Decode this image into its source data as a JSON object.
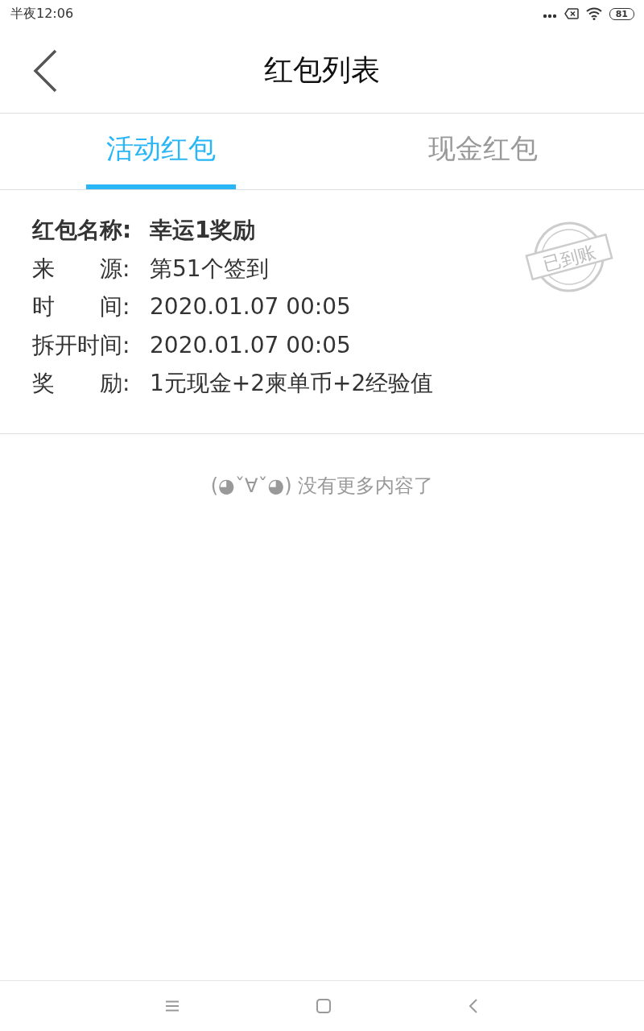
{
  "status_bar": {
    "time": "半夜12:06",
    "battery": "81"
  },
  "header": {
    "title": "红包列表"
  },
  "tabs": [
    {
      "label": "活动红包",
      "selected": true
    },
    {
      "label": "现金红包",
      "selected": false
    }
  ],
  "card": {
    "stamp": "已到账",
    "fields": [
      {
        "label": "红包名称:",
        "value": "幸运1奖励",
        "bold": true
      },
      {
        "label": "来　　源:",
        "value": "第51个签到",
        "bold": false
      },
      {
        "label": "时　　间:",
        "value": "2020.01.07 00:05",
        "bold": false
      },
      {
        "label": "拆开时间:",
        "value": "2020.01.07 00:05",
        "bold": false
      },
      {
        "label": "奖　　励:",
        "value": "1元现金+2柬单币+2经验值",
        "bold": false
      }
    ]
  },
  "end_message": "(◕ˇ∀ˇ◕) 没有更多内容了"
}
